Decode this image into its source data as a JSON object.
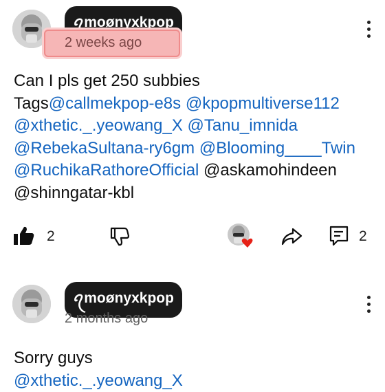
{
  "comments": [
    {
      "author": "ꪖmoønyxkpop",
      "time": "2 weeks ago",
      "lines": [
        [
          {
            "text": "Can I pls get 250 subbies",
            "mention": false
          }
        ],
        [
          {
            "text": "Tags",
            "mention": false
          },
          {
            "text": "@callmekpop-e8s",
            "mention": true
          },
          {
            "text": " ",
            "mention": false
          },
          {
            "text": "@kpopmultiverse112",
            "mention": true
          }
        ],
        [
          {
            "text": "@xthetic._.yeowang_X",
            "mention": true
          },
          {
            "text": " ",
            "mention": false
          },
          {
            "text": "@Tanu_imnida",
            "mention": true
          }
        ],
        [
          {
            "text": "@RebekaSultana-ry6gm",
            "mention": true
          },
          {
            "text": " ",
            "mention": false
          },
          {
            "text": "@Blooming____Twin",
            "mention": true
          }
        ],
        [
          {
            "text": "@RuchikaRathoreOfficial",
            "mention": true
          },
          {
            "text": " @askamohindeen",
            "mention": false
          }
        ],
        [
          {
            "text": "@shinngatar-kbl",
            "mention": false
          }
        ]
      ],
      "likes": "2",
      "replies": "2",
      "icons": {
        "like": "thumbs-up-filled-icon",
        "dislike": "thumbs-down-icon",
        "share": "share-icon",
        "reply": "reply-icon",
        "more": "more-vert-icon"
      }
    },
    {
      "author": "ꪖmoønyxkpop",
      "time": "2 months ago",
      "lines": [
        [
          {
            "text": "Sorry guys",
            "mention": false
          }
        ],
        [
          {
            "text": "@xthetic._.yeowang_X",
            "mention": true
          }
        ]
      ]
    }
  ],
  "colors": {
    "mention": "#1565c0",
    "highlight": "#f6b6b6",
    "heart": "#e62117"
  }
}
